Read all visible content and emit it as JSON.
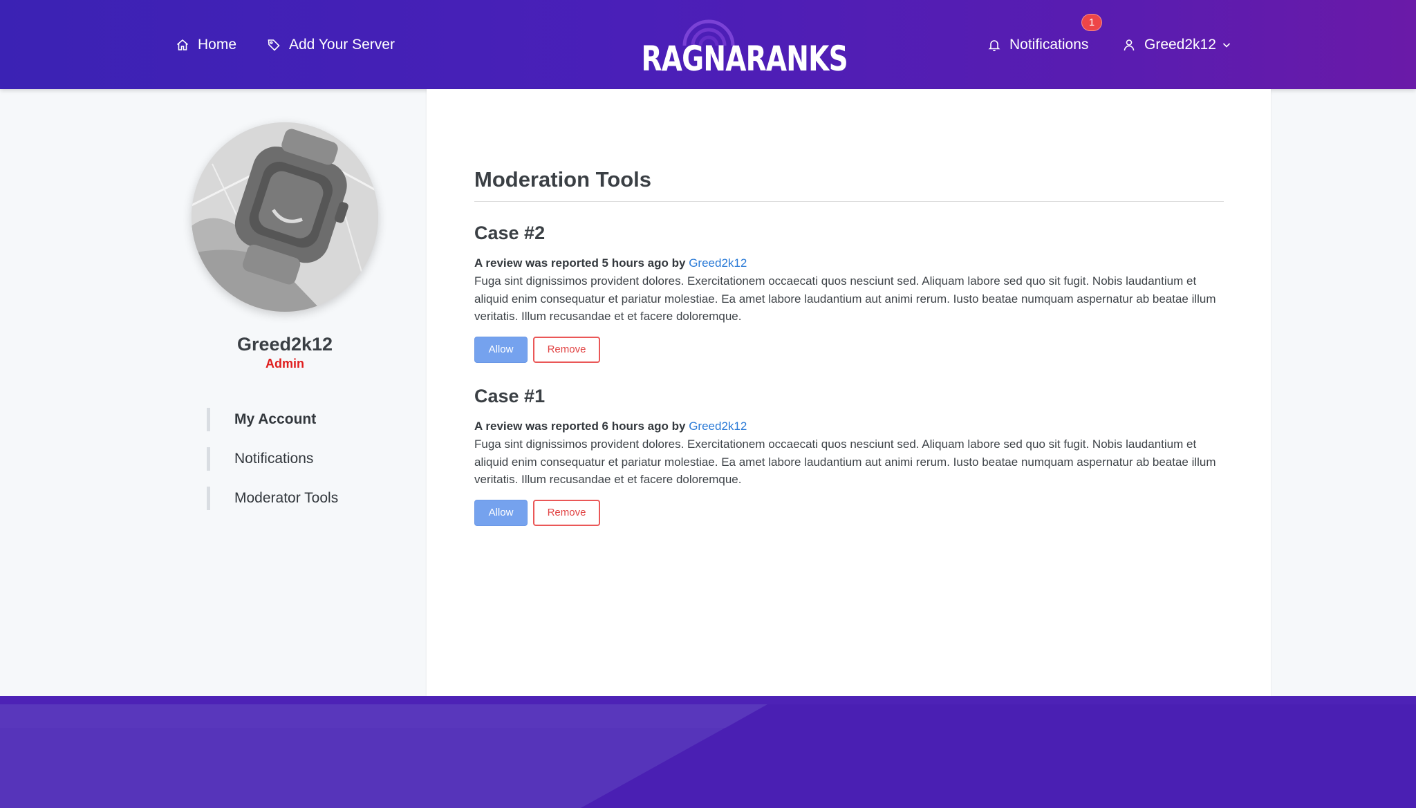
{
  "header": {
    "nav": {
      "home": "Home",
      "add_server": "Add Your Server",
      "notifications": "Notifications",
      "user": "Greed2k12"
    },
    "notification_count": "1",
    "logo_text": "RAGNARANKS"
  },
  "profile": {
    "name": "Greed2k12",
    "role": "Admin"
  },
  "sidebar": {
    "items": [
      {
        "label": "My Account",
        "active": true
      },
      {
        "label": "Notifications",
        "active": false
      },
      {
        "label": "Moderator Tools",
        "active": false
      }
    ]
  },
  "main": {
    "title": "Moderation Tools",
    "cases": [
      {
        "title": "Case #2",
        "meta": "A review was reported 5 hours ago by",
        "reporter": "Greed2k12",
        "body": "Fuga sint dignissimos provident dolores. Exercitationem occaecati quos nesciunt sed. Aliquam labore sed quo sit fugit. Nobis laudantium et aliquid enim consequatur et pariatur molestiae. Ea amet labore laudantium aut animi rerum. Iusto beatae numquam aspernatur ab beatae illum veritatis. Illum recusandae et et facere doloremque.",
        "allow_label": "Allow",
        "remove_label": "Remove"
      },
      {
        "title": "Case #1",
        "meta": "A review was reported 6 hours ago by",
        "reporter": "Greed2k12",
        "body": "Fuga sint dignissimos provident dolores. Exercitationem occaecati quos nesciunt sed. Aliquam labore sed quo sit fugit. Nobis laudantium et aliquid enim consequatur et pariatur molestiae. Ea amet labore laudantium aut animi rerum. Iusto beatae numquam aspernatur ab beatae illum veritatis. Illum recusandae et et facere doloremque.",
        "allow_label": "Allow",
        "remove_label": "Remove"
      }
    ]
  },
  "colors": {
    "header_gradient_start": "#3b22b4",
    "header_gradient_end": "#6a1aa8",
    "link": "#2a7ad6",
    "admin": "#e01e1e",
    "allow_button": "#75a2ee",
    "remove_button": "#ea5757",
    "badge": "#ee4548",
    "footer": "#4a1fb3"
  }
}
